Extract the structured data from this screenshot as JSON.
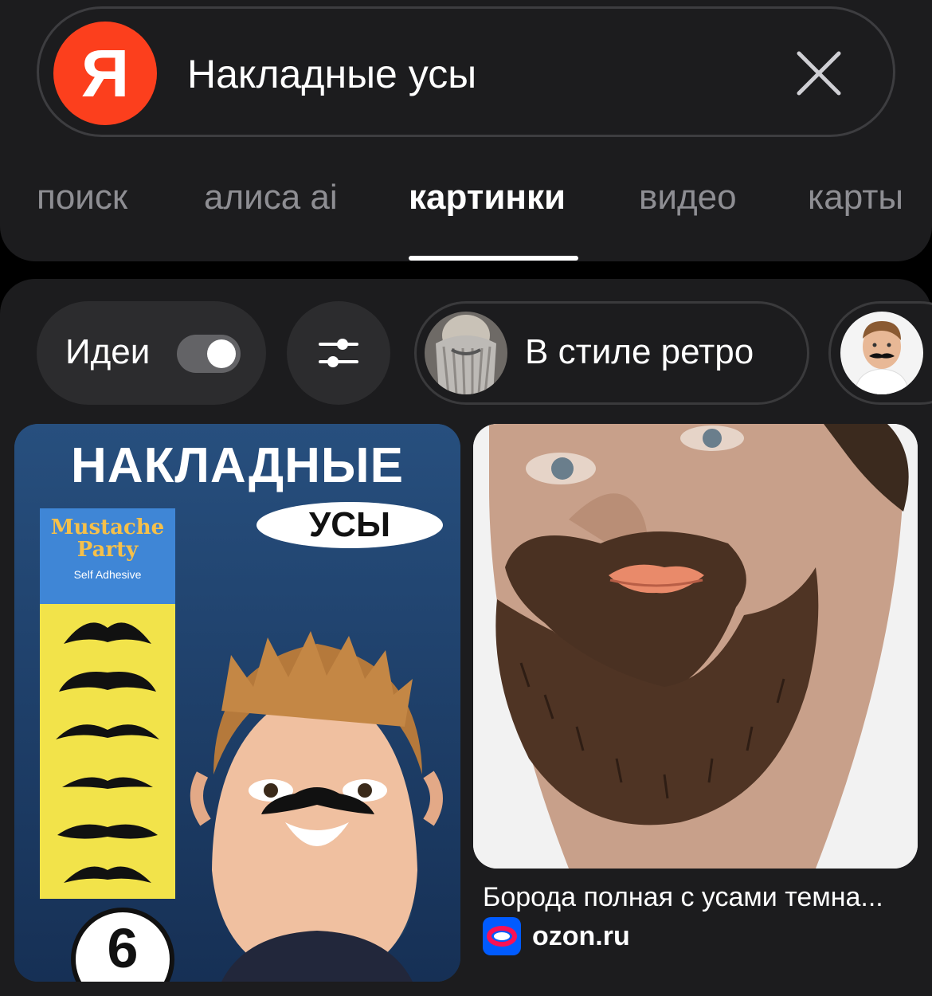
{
  "search": {
    "logo_letter": "Я",
    "query": "Накладные усы"
  },
  "tabs": [
    {
      "label": "поиск",
      "active": false
    },
    {
      "label": "алиса ai",
      "active": false
    },
    {
      "label": "картинки",
      "active": true
    },
    {
      "label": "видео",
      "active": false
    },
    {
      "label": "карты",
      "active": false
    }
  ],
  "filters": {
    "ideas_label": "Идеи",
    "ideas_toggle": true,
    "retro_label": "В стиле ретро"
  },
  "results": {
    "left": {
      "poster_title": "НАКЛАДНЫЕ",
      "poster_sub": "УСЫ",
      "pack_brand": "Mustache Party",
      "pack_sub": "Self Adhesive",
      "badge": "6"
    },
    "right": {
      "caption": "Борода полная с усами темна...",
      "source": "ozon.ru"
    }
  },
  "colors": {
    "brand": "#fc3f1d",
    "background": "#000000",
    "panel": "#1c1c1e",
    "ozon_blue": "#005bff",
    "ozon_pink": "#f91155"
  }
}
